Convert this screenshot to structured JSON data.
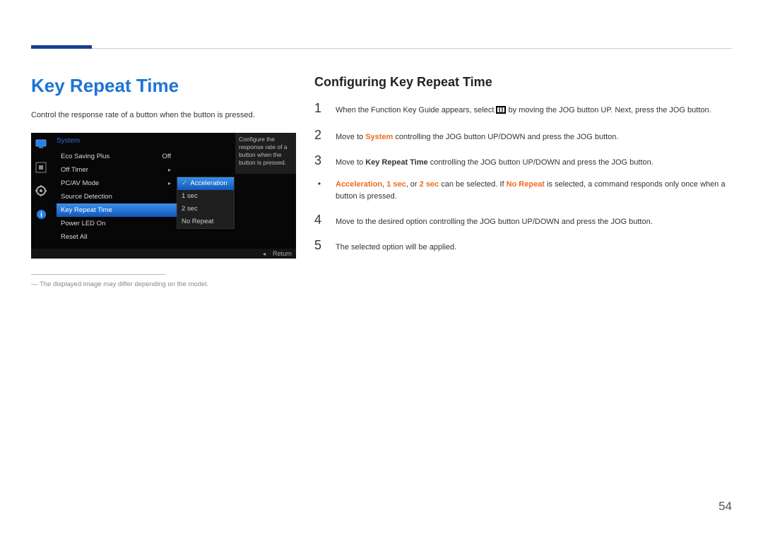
{
  "page_number": "54",
  "section_title": "Key Repeat Time",
  "intro_text": "Control the response rate of a button when the button is pressed.",
  "caption": "The displayed image may differ depending on the model.",
  "osd": {
    "title": "System",
    "menu": [
      {
        "label": "Eco Saving Plus",
        "value": "Off"
      },
      {
        "label": "Off Timer",
        "value": "▸"
      },
      {
        "label": "PC/AV Mode",
        "value": "▸"
      },
      {
        "label": "Source Detection",
        "value": ""
      },
      {
        "label": "Key Repeat Time",
        "value": ""
      },
      {
        "label": "Power LED On",
        "value": ""
      },
      {
        "label": "Reset All",
        "value": ""
      }
    ],
    "submenu": [
      {
        "label": "Acceleration",
        "selected": true
      },
      {
        "label": "1 sec"
      },
      {
        "label": "2 sec"
      },
      {
        "label": "No Repeat"
      }
    ],
    "desc": "Configure the response rate of a button when the button is pressed.",
    "return_back": "◂",
    "return_label": "Return"
  },
  "right": {
    "subtitle": "Configuring Key Repeat Time",
    "steps": {
      "s1_a": "When the Function Key Guide appears, select ",
      "s1_b": " by moving the JOG button UP. Next, press the JOG button.",
      "s2_a": "Move to ",
      "s2_system": "System",
      "s2_b": " controlling the JOG button UP/DOWN and press the JOG button.",
      "s3_a": "Move to ",
      "s3_krt": "Key Repeat Time",
      "s3_b": " controlling the JOG button UP/DOWN and press the JOG button.",
      "bullet_accel": "Acceleration",
      "bullet_1sec": "1 sec",
      "bullet_comma": ", ",
      "bullet_or": ", or ",
      "bullet_2sec": "2 sec",
      "bullet_mid": " can be selected. If ",
      "bullet_norepeat": "No Repeat",
      "bullet_end": " is selected, a command responds only once when a button is pressed.",
      "s4": "Move to the desired option controlling the JOG button UP/DOWN and press the JOG button.",
      "s5": "The selected option will be applied."
    }
  }
}
